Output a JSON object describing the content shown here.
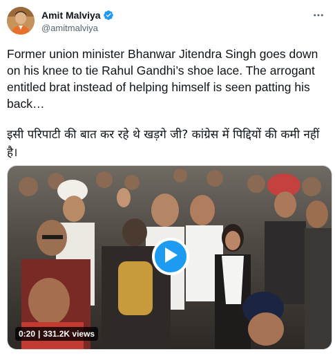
{
  "author": {
    "display_name": "Amit Malviya",
    "handle": "@amitmalviya",
    "verified": true
  },
  "icons": {
    "verified": "verified-badge-icon",
    "more": "more-horizontal-icon",
    "play": "play-icon"
  },
  "tweet": {
    "text_en": "Former union minister Bhanwar Jitendra Singh goes down on his knee to tie Rahul Gandhi’s shoe lace. The arrogant entitled brat instead of helping himself is seen patting his back…",
    "text_hi": "इसी परिपाटी की बात कर रहे थे खड़गे जी? कांग्रेस में पिद्दियों की कमी नहीं है।"
  },
  "video": {
    "duration": "0:20",
    "separator": "|",
    "views": "331.2K views"
  },
  "colors": {
    "accent": "#1d9bf0",
    "text": "#0f1419",
    "secondary_text": "#536471"
  }
}
